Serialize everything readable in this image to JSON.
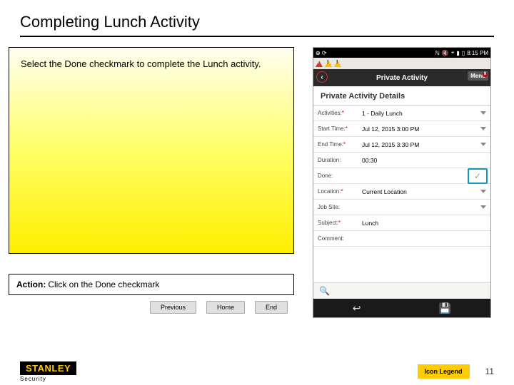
{
  "title": "Completing Lunch Activity",
  "instruction": "Select the Done checkmark to complete the Lunch activity.",
  "action": {
    "label": "Action:",
    "text": "Click on the Done checkmark"
  },
  "nav": {
    "prev": "Previous",
    "home": "Home",
    "end": "End"
  },
  "footer": {
    "brand": "STANLEY",
    "brand_sub": "Security",
    "legend": "Icon Legend",
    "page": "11"
  },
  "phone": {
    "status": {
      "time": "8:15 PM"
    },
    "header": {
      "title": "Private Activity",
      "menu": "Menu",
      "menu_badge": "9"
    },
    "panel": "Private Activity Details",
    "rows": {
      "activities": {
        "lbl": "Activities:",
        "req": "*",
        "val": "1 - Daily Lunch"
      },
      "start": {
        "lbl": "Start Time:",
        "req": "*",
        "val": "Jul 12, 2015 3:00 PM"
      },
      "end": {
        "lbl": "End Time:",
        "req": "*",
        "val": "Jul 12, 2015 3:30 PM"
      },
      "duration": {
        "lbl": "Duration:",
        "val": "00:30"
      },
      "done": {
        "lbl": "Done:"
      },
      "location": {
        "lbl": "Location:",
        "req": "*",
        "val": "Current Location"
      },
      "jobsite": {
        "lbl": "Job Site:"
      },
      "subject": {
        "lbl": "Subject:",
        "req": "*",
        "val": "Lunch"
      },
      "comment": {
        "lbl": "Comment:"
      }
    }
  }
}
